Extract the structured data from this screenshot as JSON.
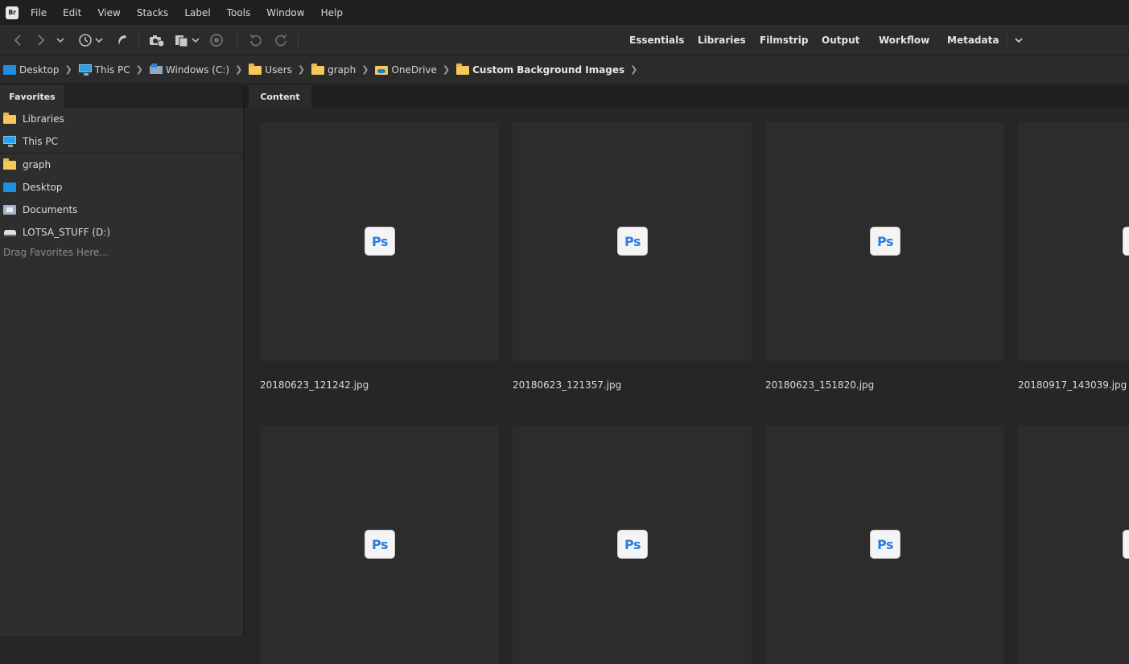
{
  "app": {
    "logo_text": "Br"
  },
  "menu": [
    "File",
    "Edit",
    "View",
    "Stacks",
    "Label",
    "Tools",
    "Window",
    "Help"
  ],
  "toolbar": {
    "icons": [
      "back-icon",
      "forward-icon",
      "history-dropdown-icon",
      "recent-icon",
      "boomerang-icon",
      "camera-get-photos-icon",
      "copy-dropdown-icon",
      "refine-icon",
      "rotate-left-icon",
      "rotate-right-icon"
    ],
    "workspaces": [
      "Essentials",
      "Libraries",
      "Filmstrip",
      "Output",
      "Workflow",
      "Metadata"
    ],
    "more_icon": "chevron-down-icon"
  },
  "breadcrumb": [
    {
      "label": "Desktop",
      "icon": "desktop-icon"
    },
    {
      "label": "This PC",
      "icon": "pc-icon"
    },
    {
      "label": "Windows (C:)",
      "icon": "drive-c-icon"
    },
    {
      "label": "Users",
      "icon": "folder-icon"
    },
    {
      "label": "graph",
      "icon": "folder-icon"
    },
    {
      "label": "OneDrive",
      "icon": "onedrive-folder-icon"
    },
    {
      "label": "Custom Background Images",
      "icon": "folder-icon"
    }
  ],
  "favorites": {
    "tab_label": "Favorites",
    "items": [
      {
        "label": "Libraries",
        "icon": "folder-icon"
      },
      {
        "label": "This PC",
        "icon": "pc-icon"
      },
      {
        "label": "graph",
        "icon": "folder-icon"
      },
      {
        "label": "Desktop",
        "icon": "desktop-icon"
      },
      {
        "label": "Documents",
        "icon": "documents-icon"
      },
      {
        "label": "LOTSA_STUFF (D:)",
        "icon": "drive-icon"
      }
    ],
    "hint": "Drag Favorites Here..."
  },
  "content": {
    "tab_label": "Content",
    "badge_text": "Ps",
    "thumbnails": [
      {
        "name": "20180623_121242.jpg"
      },
      {
        "name": "20180623_121357.jpg"
      },
      {
        "name": "20180623_151820.jpg"
      },
      {
        "name": "20180917_143039.jpg"
      },
      {
        "name": ""
      },
      {
        "name": ""
      },
      {
        "name": ""
      },
      {
        "name": ""
      }
    ]
  },
  "colors": {
    "accent_ps": "#2a7fe0",
    "folder": "#f4c85a",
    "panel": "#2e2e2e",
    "background": "#262626"
  }
}
